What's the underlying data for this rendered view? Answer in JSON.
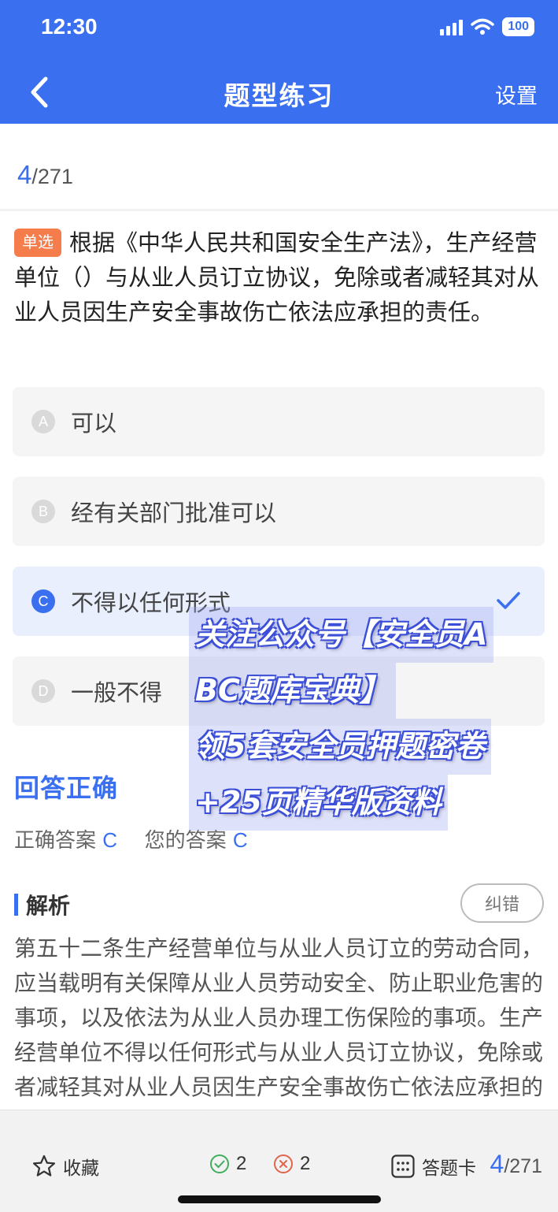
{
  "status_bar": {
    "time": "12:30",
    "battery": "100"
  },
  "nav": {
    "title": "题型练习",
    "settings_label": "设置"
  },
  "progress": {
    "current": "4",
    "total": "/271"
  },
  "question": {
    "type_tag": "单选",
    "text": "根据《中华人民共和国安全生产法》，生产经营单位（）与从业人员订立协议，免除或者减轻其对从业人员因生产安全事故伤亡依法应承担的责任。"
  },
  "options": [
    {
      "letter": "A",
      "text": "可以"
    },
    {
      "letter": "B",
      "text": "经有关部门批准可以"
    },
    {
      "letter": "C",
      "text": "不得以任何形式"
    },
    {
      "letter": "D",
      "text": "一般不得"
    }
  ],
  "result": {
    "status": "回答正确",
    "correct_label": "正确答案",
    "correct_value": "C",
    "yours_label": "您的答案",
    "yours_value": "C"
  },
  "analysis": {
    "title": "解析",
    "report_label": "纠错",
    "text": "第五十二条生产经营单位与从业人员订立的劳动合同，应当载明有关保障从业人员劳动安全、防止职业危害的事项，以及依法为从业人员办理工伤保险的事项。生产经营单位不得以任何形式与从业人员订立协议，免除或者减轻其对从业人员因生产安全事故伤亡依法应承担的责任。"
  },
  "overlay": {
    "lines": [
      "关注公众号【安全员A",
      "BC题库宝典】",
      "领5套安全员押题密卷",
      "+25页精华版资料"
    ]
  },
  "bottom_bar": {
    "favorite_label": "收藏",
    "correct_count": "2",
    "wrong_count": "2",
    "answer_card_label": "答题卡",
    "progress_current": "4",
    "progress_total": "/271"
  },
  "colors": {
    "accent": "#3a6ff0",
    "tag": "#f57c4b",
    "correct_bg": "#e9effd"
  },
  "icons": [
    "back-icon",
    "check-icon",
    "star-icon",
    "correct-count-icon",
    "wrong-count-icon",
    "answer-card-icon",
    "wifi-icon",
    "signal-icon"
  ]
}
